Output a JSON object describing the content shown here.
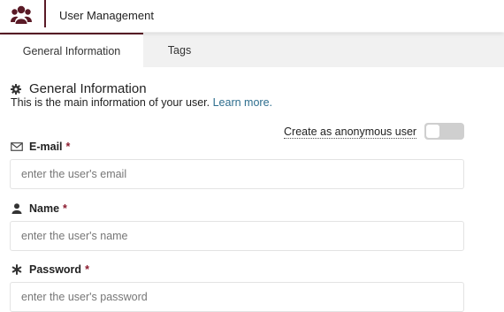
{
  "header": {
    "title": "User Management",
    "logo_icon": "users-group-icon",
    "accent_color": "#5a1a26"
  },
  "tabs": [
    {
      "label": "General Information",
      "active": true
    },
    {
      "label": "Tags",
      "active": false
    }
  ],
  "section": {
    "title": "General Information",
    "icon": "gear-icon",
    "description": "This is the main information of your user.",
    "learn_more": "Learn more."
  },
  "anonymous": {
    "label": "Create as anonymous user",
    "enabled": false
  },
  "fields": {
    "email": {
      "label": "E-mail",
      "required_mark": "*",
      "icon": "envelope-icon",
      "value": "",
      "placeholder": "enter the user's email"
    },
    "name": {
      "label": "Name",
      "required_mark": "*",
      "icon": "user-icon",
      "value": "",
      "placeholder": "enter the user's name"
    },
    "password": {
      "label": "Password",
      "required_mark": "*",
      "icon": "asterisk-icon",
      "value": "",
      "placeholder": "enter the user's password"
    }
  }
}
